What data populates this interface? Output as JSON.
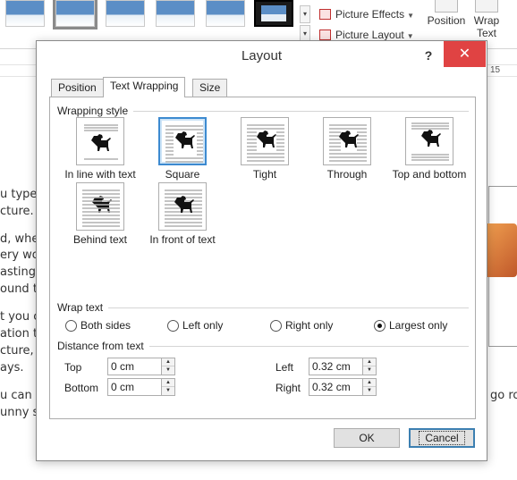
{
  "ribbon": {
    "picture_effects_label": "Picture Effects",
    "picture_layout_label": "Picture Layout",
    "position_label": "Position",
    "wrap_text_label": "Wrap Text",
    "ruler_right_number": "15"
  },
  "document": {
    "lines": [
      "u type",
      "cture.",
      "d, whe",
      "ery wo",
      "asting s",
      "ound th",
      "t you c",
      "ation t",
      "cture, c",
      "ays.",
      "u can e",
      "unny s"
    ],
    "right_fragment": "go ro"
  },
  "dialog": {
    "title": "Layout",
    "help_label": "?",
    "close_label": "✕",
    "tabs": [
      {
        "label": "Position",
        "active": false
      },
      {
        "label": "Text Wrapping",
        "active": true
      },
      {
        "label": "Size",
        "active": false
      }
    ],
    "wrapping_style": {
      "group_label": "Wrapping style",
      "options": [
        {
          "key": "inline",
          "label": "In line with text",
          "selected": false
        },
        {
          "key": "square",
          "label": "Square",
          "selected": true
        },
        {
          "key": "tight",
          "label": "Tight",
          "selected": false
        },
        {
          "key": "through",
          "label": "Through",
          "selected": false
        },
        {
          "key": "topbottom",
          "label": "Top and bottom",
          "selected": false
        },
        {
          "key": "behind",
          "label": "Behind text",
          "selected": false
        },
        {
          "key": "front",
          "label": "In front of text",
          "selected": false
        }
      ]
    },
    "wrap_text": {
      "group_label": "Wrap text",
      "options": [
        {
          "label": "Both sides",
          "checked": false
        },
        {
          "label": "Left only",
          "checked": false
        },
        {
          "label": "Right only",
          "checked": false
        },
        {
          "label": "Largest only",
          "checked": true
        }
      ]
    },
    "distance": {
      "group_label": "Distance from text",
      "top_label": "Top",
      "top_value": "0 cm",
      "bottom_label": "Bottom",
      "bottom_value": "0 cm",
      "left_label": "Left",
      "left_value": "0.32 cm",
      "right_label": "Right",
      "right_value": "0.32 cm"
    },
    "ok_label": "OK",
    "cancel_label": "Cancel"
  }
}
